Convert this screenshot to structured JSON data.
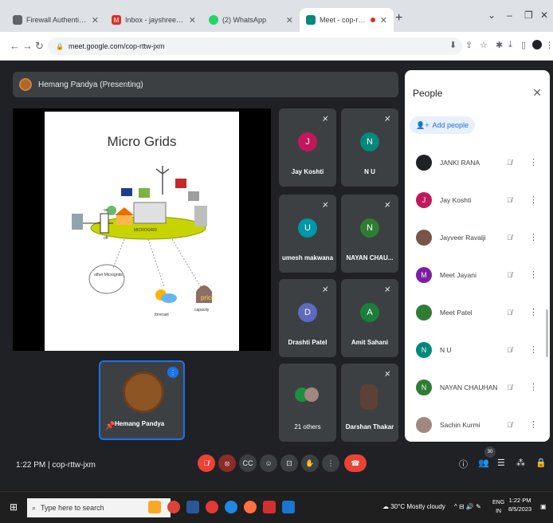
{
  "browser": {
    "tabs": [
      {
        "title": "Firewall Authentication Keepalive",
        "favicon_color": "#5f6368",
        "icon": "firewall-icon"
      },
      {
        "title": "Inbox - jayshreeramdarshan@gmail",
        "favicon_color": "#d93025",
        "icon": "gmail-icon"
      },
      {
        "title": "(2) WhatsApp",
        "favicon_color": "#25d366",
        "icon": "whatsapp-icon"
      },
      {
        "title": "Meet - cop-rttw-jxm",
        "favicon_color": "#00897b",
        "icon": "meet-icon"
      }
    ],
    "new_tab": "+",
    "url": "meet.google.com/cop-rttw-jxm"
  },
  "meet": {
    "presenter_banner": "Hemang Pandya (Presenting)",
    "slide_title": "Micro Grids",
    "slide_labels": [
      "on",
      "off",
      "MICROGRID",
      "other Microgrids",
      "forecast",
      "price",
      "capacity"
    ],
    "tiles": [
      {
        "name": "Jay Koshti",
        "initial": "J",
        "color": "#c2185b"
      },
      {
        "name": "N U",
        "initial": "N",
        "color": "#00897b"
      },
      {
        "name": "umesh makwana",
        "initial": "U",
        "color": "#0097a7"
      },
      {
        "name": "NAYAN CHAU...",
        "initial": "N",
        "color": "#2e7d32"
      },
      {
        "name": "Drashti Patel",
        "initial": "D",
        "color": "#5c6bc0"
      },
      {
        "name": "Amit Sahani",
        "initial": "A",
        "color": "#1b7f3b"
      },
      {
        "name": "21 others",
        "initial": "",
        "color": "#3c4043"
      },
      {
        "name": "Darshan Thakar",
        "initial": "",
        "color": "#5d4037"
      }
    ],
    "self_tile": {
      "name": "Hemang Pandya"
    },
    "clock": "1:22 PM",
    "meeting_code": "cop-rttw-jxm",
    "participant_count": "30"
  },
  "people": {
    "header": "People",
    "add_label": "Add people",
    "list": [
      {
        "name": "JANKI RANA",
        "initial": "",
        "color": "#202124"
      },
      {
        "name": "Jay Koshti",
        "initial": "J",
        "color": "#c2185b"
      },
      {
        "name": "Jayveer Ravalji",
        "initial": "",
        "color": "#795548"
      },
      {
        "name": "Meet Jayani",
        "initial": "M",
        "color": "#7b1fa2"
      },
      {
        "name": "Meet Patel",
        "initial": "",
        "color": "#2e7d32"
      },
      {
        "name": "N U",
        "initial": "N",
        "color": "#00897b"
      },
      {
        "name": "NAYAN CHAUHAN",
        "initial": "N",
        "color": "#2e7d32"
      },
      {
        "name": "Sachin Kurmi",
        "initial": "",
        "color": "#a1887f"
      }
    ]
  },
  "taskbar": {
    "search_placeholder": "Type here to search",
    "weather": "30°C  Mostly cloudy",
    "lang1": "ENG",
    "lang2": "IN",
    "time": "1:22 PM",
    "date": "8/5/2023"
  }
}
